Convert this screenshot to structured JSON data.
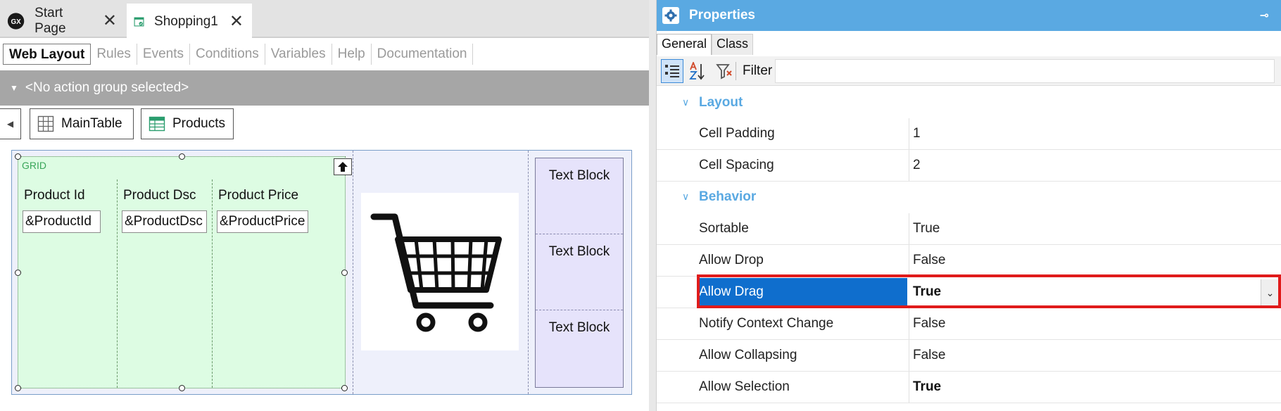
{
  "doc_tabs": {
    "start": {
      "label": "Start Page",
      "icon": "genexus-logo-icon",
      "logo_text": "GX"
    },
    "shopping": {
      "label": "Shopping1",
      "icon": "webpanel-icon"
    }
  },
  "sub_tabs": [
    "Web Layout",
    "Rules",
    "Events",
    "Conditions",
    "Variables",
    "Help",
    "Documentation"
  ],
  "action_group": "<No action group selected>",
  "breadcrumbs": {
    "main_table": "MainTable",
    "products": "Products"
  },
  "canvas": {
    "grid_label": "GRID",
    "columns": [
      {
        "header": "Product Id",
        "field": "&ProductId"
      },
      {
        "header": "Product Dsc",
        "field": "&ProductDsc"
      },
      {
        "header": "Product Price",
        "field": "&ProductPrice"
      }
    ],
    "text_blocks": [
      "Text Block",
      "Text Block",
      "Text Block"
    ]
  },
  "properties": {
    "title": "Properties",
    "tabs": {
      "general": "General",
      "class": "Class"
    },
    "filter_label": "Filter",
    "filter_value": "",
    "categories": [
      {
        "name": "Layout",
        "rows": [
          {
            "name": "Cell Padding",
            "value": "1"
          },
          {
            "name": "Cell Spacing",
            "value": "2"
          }
        ]
      },
      {
        "name": "Behavior",
        "rows": [
          {
            "name": "Sortable",
            "value": "True"
          },
          {
            "name": "Allow Drop",
            "value": "False"
          },
          {
            "name": "Allow Drag",
            "value": "True"
          },
          {
            "name": "Notify Context Change",
            "value": "False"
          },
          {
            "name": "Allow Collapsing",
            "value": "False"
          },
          {
            "name": "Allow Selection",
            "value": "True"
          }
        ]
      }
    ]
  },
  "colors": {
    "accent": "#5aa9e2",
    "selected_row": "#0f6ecd",
    "highlight_border": "#e01b1b",
    "grid_bg": "#ddfce3"
  }
}
